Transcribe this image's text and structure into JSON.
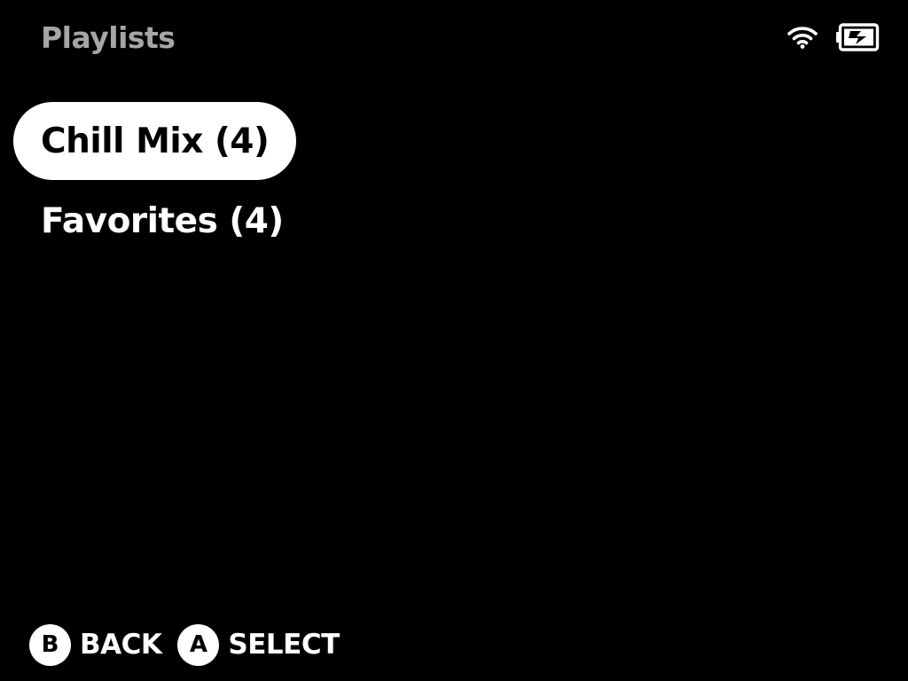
{
  "header": {
    "title": "Playlists"
  },
  "status": {
    "wifi_icon": "wifi-icon",
    "battery_icon": "battery-charging-icon"
  },
  "playlists": [
    {
      "label": "Chill Mix (4)",
      "selected": true
    },
    {
      "label": "Favorites (4)",
      "selected": false
    }
  ],
  "footer": {
    "hints": [
      {
        "button": "B",
        "label": "BACK"
      },
      {
        "button": "A",
        "label": "SELECT"
      }
    ]
  },
  "colors": {
    "background": "#000000",
    "text": "#ffffff",
    "title": "#a6a6a6",
    "selection": "#ffffff"
  }
}
